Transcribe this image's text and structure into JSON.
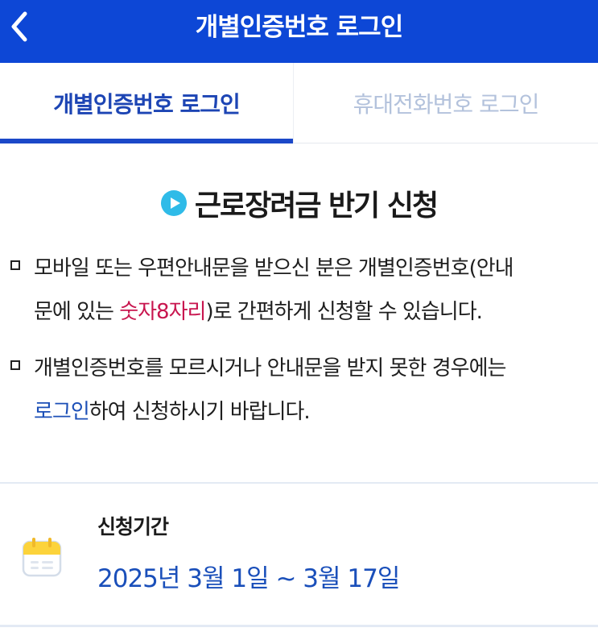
{
  "header": {
    "title": "개별인증번호 로그인",
    "back_icon": "chevron-left-icon"
  },
  "tabs": [
    {
      "label": "개별인증번호 로그인",
      "active": true
    },
    {
      "label": "휴대전화번호 로그인",
      "active": false
    }
  ],
  "section": {
    "icon": "play-circle-icon",
    "title": "근로장려금 반기 신청"
  },
  "notices": [
    {
      "line1": "모바일 또는 우편안내문을 받으신 분은 개별인증번호(안내",
      "line2_prefix": "문에 있는 ",
      "line2_highlight": "숫자8자리",
      "line2_suffix": ")로 간편하게 신청할 수 있습니다."
    },
    {
      "line1": "개별인증번호를 모르시거나 안내문을 받지 못한 경우에는",
      "line2_link": "로그인",
      "line2_suffix": "하여 신청하시기 바랍니다."
    }
  ],
  "period": {
    "icon": "calendar-icon",
    "label": "신청기간",
    "value": "2025년 3월 1일 ~ 3월 17일"
  },
  "colors": {
    "header_bg": "#0d47d6",
    "active_tab": "#1d45b4",
    "inactive_tab": "#b3c2dc",
    "highlight_red": "#c8164f",
    "link_blue": "#1c4fb7",
    "play_icon": "#2fbbe8"
  }
}
